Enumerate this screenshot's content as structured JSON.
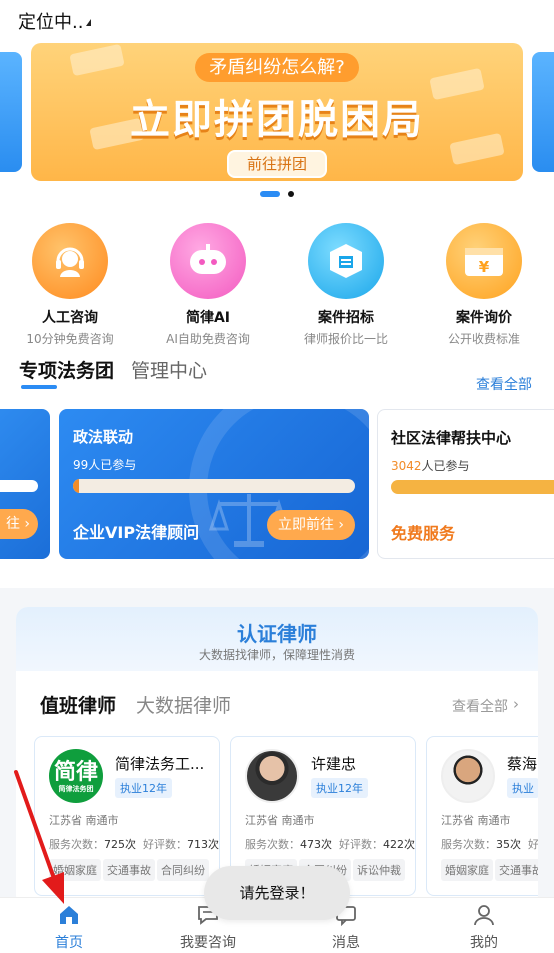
{
  "location": {
    "label": "定位中.."
  },
  "banner": {
    "subtitle": "矛盾纠纷怎么解?",
    "title": "立即拼团脱困局",
    "button": "前往拼团",
    "active_index": 0,
    "count": 2
  },
  "quick_actions": [
    {
      "icon": "headset-icon",
      "label": "人工咨询",
      "desc": "10分钟免费咨询",
      "color": "#ff9a2e"
    },
    {
      "icon": "ai-robot-icon",
      "label": "简律AI",
      "desc": "AI自助免费咨询",
      "color": "#ff6fc8"
    },
    {
      "icon": "cube-box-icon",
      "label": "案件招标",
      "desc": "律师报价比一比",
      "color": "#2bb8f2"
    },
    {
      "icon": "wallet-yen-icon",
      "label": "案件询价",
      "desc": "公开收费标准",
      "color": "#ffb02e"
    }
  ],
  "teams": {
    "tabs": [
      "专项法务团",
      "管理中心"
    ],
    "view_all": "查看全部",
    "left_card": {
      "button_tail": "往"
    },
    "middle_card": {
      "title": "政法联动",
      "count": "99人已参与",
      "subtitle": "企业VIP法律顾问",
      "button": "立即前往",
      "progress": 0.02
    },
    "right_card": {
      "title": "社区法律帮扶中心",
      "count_num": "3042",
      "count_suffix": "人已参与",
      "free": "免费服务"
    }
  },
  "lawyers": {
    "title": "认证律师",
    "subtitle": "大数据找律师，保障理性消费",
    "tabs": [
      "值班律师",
      "大数据律师"
    ],
    "view_all": "查看全部",
    "cards": [
      {
        "name": "简律法务工...",
        "badge": "执业12年",
        "location": "江苏省  南通市",
        "service_label": "服务次数：",
        "service": "725次",
        "review_label": "好评数：",
        "review": "713次",
        "tags": [
          "婚姻家庭",
          "交通事故",
          "合同纠纷"
        ],
        "logo_text": "简律",
        "logo_small": "简律法务团"
      },
      {
        "name": "许建忠",
        "badge": "执业12年",
        "location": "江苏省  南通市",
        "service_label": "服务次数：",
        "service": "473次",
        "review_label": "好评数：",
        "review": "422次",
        "tags": [
          "婚姻家庭",
          "合同纠纷",
          "诉讼仲裁"
        ]
      },
      {
        "name": "蔡海",
        "badge": "执业",
        "location": "江苏省  南通市",
        "service_label": "服务次数：",
        "service": "35次",
        "review_label": "好评",
        "review": "",
        "tags": [
          "婚姻家庭",
          "交通事故"
        ]
      }
    ]
  },
  "toast": "请先登录！",
  "tabbar": [
    {
      "icon": "home-icon",
      "label": "首页",
      "active": true
    },
    {
      "icon": "chat-icon",
      "label": "我要咨询",
      "active": false
    },
    {
      "icon": "message-icon",
      "label": "消息",
      "active": false
    },
    {
      "icon": "user-icon",
      "label": "我的",
      "active": false
    }
  ],
  "colors": {
    "accent": "#2b8cf4",
    "orange": "#ffa94d",
    "annotation_arrow": "#e21b1b"
  }
}
